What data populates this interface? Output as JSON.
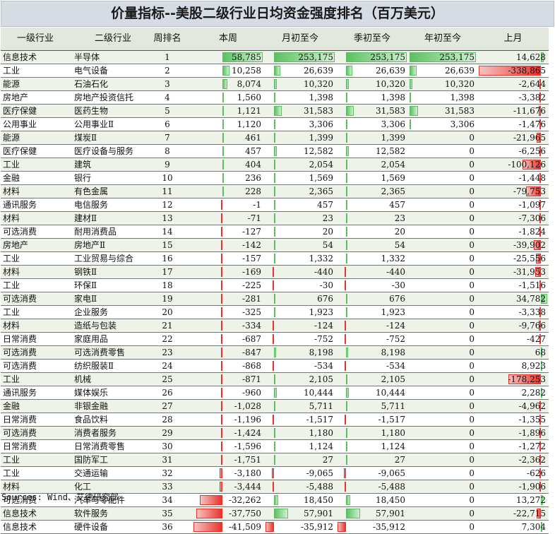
{
  "title": "价量指标--美股二级行业日均资金强度排名（百万美元）",
  "source": "Sources: Wind、艾德研究部",
  "chart_data": {
    "type": "table",
    "columns": [
      "一级行业",
      "二级行业",
      "周排名",
      "本周",
      "月初至今",
      "季初至今",
      "年初至今",
      "上月"
    ],
    "rows": [
      {
        "l1": "信息技术",
        "l2": "半导体",
        "rank": "1",
        "week": 58785,
        "week_s": "58,785",
        "mtd": 253175,
        "mtd_s": "253,175",
        "qtd": 253175,
        "qtd_s": "253,175",
        "ytd": 253175,
        "ytd_s": "253,175",
        "lm": 14628,
        "lm_s": "14,628"
      },
      {
        "l1": "工业",
        "l2": "电气设备",
        "rank": "2",
        "week": 10258,
        "week_s": "10,258",
        "mtd": 26639,
        "mtd_s": "26,639",
        "qtd": 26639,
        "qtd_s": "26,639",
        "ytd": 26639,
        "ytd_s": "26,639",
        "lm": -338865,
        "lm_s": "-338,865"
      },
      {
        "l1": "能源",
        "l2": "石油石化",
        "rank": "3",
        "week": 8074,
        "week_s": "8,074",
        "mtd": 10320,
        "mtd_s": "10,320",
        "qtd": 10320,
        "qtd_s": "10,320",
        "ytd": 10320,
        "ytd_s": "10,320",
        "lm": -2644,
        "lm_s": "-2,644"
      },
      {
        "l1": "房地产",
        "l2": "房地产投资信托",
        "rank": "4",
        "week": 1560,
        "week_s": "1,560",
        "mtd": 1398,
        "mtd_s": "1,398",
        "qtd": 1398,
        "qtd_s": "1,398",
        "ytd": 1398,
        "ytd_s": "1,398",
        "lm": -3382,
        "lm_s": "-3,382"
      },
      {
        "l1": "医疗保健",
        "l2": "医药生物",
        "rank": "5",
        "week": 1121,
        "week_s": "1,121",
        "mtd": 31583,
        "mtd_s": "31,583",
        "qtd": 31583,
        "qtd_s": "31,583",
        "ytd": 31583,
        "ytd_s": "31,583",
        "lm": -11676,
        "lm_s": "-11,676"
      },
      {
        "l1": "公用事业",
        "l2": "公用事业Ⅱ",
        "rank": "6",
        "week": 1120,
        "week_s": "1,120",
        "mtd": 3306,
        "mtd_s": "3,306",
        "qtd": 3306,
        "qtd_s": "3,306",
        "ytd": 3306,
        "ytd_s": "3,306",
        "lm": -1476,
        "lm_s": "-1,476"
      },
      {
        "l1": "能源",
        "l2": "煤炭Ⅱ",
        "rank": "7",
        "week": 461,
        "week_s": "461",
        "mtd": 1399,
        "mtd_s": "1,399",
        "qtd": 1399,
        "qtd_s": "1,399",
        "ytd": 0,
        "ytd_s": "0",
        "lm": -21965,
        "lm_s": "-21,965"
      },
      {
        "l1": "医疗保健",
        "l2": "医疗设备与服务",
        "rank": "8",
        "week": 457,
        "week_s": "457",
        "mtd": 12582,
        "mtd_s": "12,582",
        "qtd": 12582,
        "qtd_s": "12,582",
        "ytd": 0,
        "ytd_s": "0",
        "lm": -6256,
        "lm_s": "-6,256"
      },
      {
        "l1": "工业",
        "l2": "建筑",
        "rank": "9",
        "week": 404,
        "week_s": "404",
        "mtd": 2054,
        "mtd_s": "2,054",
        "qtd": 2054,
        "qtd_s": "2,054",
        "ytd": 0,
        "ytd_s": "0",
        "lm": -100126,
        "lm_s": "-100,126"
      },
      {
        "l1": "金融",
        "l2": "银行",
        "rank": "10",
        "week": 236,
        "week_s": "236",
        "mtd": 1569,
        "mtd_s": "1,569",
        "qtd": 1569,
        "qtd_s": "1,569",
        "ytd": 0,
        "ytd_s": "0",
        "lm": -1448,
        "lm_s": "-1,448"
      },
      {
        "l1": "材料",
        "l2": "有色金属",
        "rank": "11",
        "week": 228,
        "week_s": "228",
        "mtd": 2365,
        "mtd_s": "2,365",
        "qtd": 2365,
        "qtd_s": "2,365",
        "ytd": 0,
        "ytd_s": "0",
        "lm": -79753,
        "lm_s": "-79,753"
      },
      {
        "l1": "通讯服务",
        "l2": "电信服务",
        "rank": "12",
        "week": -1,
        "week_s": "-1",
        "mtd": 457,
        "mtd_s": "457",
        "qtd": 457,
        "qtd_s": "457",
        "ytd": 0,
        "ytd_s": "0",
        "lm": -1097,
        "lm_s": "-1,097"
      },
      {
        "l1": "材料",
        "l2": "建材Ⅱ",
        "rank": "13",
        "week": -71,
        "week_s": "-71",
        "mtd": 23,
        "mtd_s": "23",
        "qtd": 23,
        "qtd_s": "23",
        "ytd": 0,
        "ytd_s": "0",
        "lm": -7306,
        "lm_s": "-7,306"
      },
      {
        "l1": "可选消费",
        "l2": "耐用消费品",
        "rank": "14",
        "week": -127,
        "week_s": "-127",
        "mtd": 20,
        "mtd_s": "20",
        "qtd": 20,
        "qtd_s": "20",
        "ytd": 0,
        "ytd_s": "0",
        "lm": -1824,
        "lm_s": "-1,824"
      },
      {
        "l1": "房地产",
        "l2": "房地产Ⅱ",
        "rank": "15",
        "week": -142,
        "week_s": "-142",
        "mtd": 54,
        "mtd_s": "54",
        "qtd": 54,
        "qtd_s": "54",
        "ytd": 0,
        "ytd_s": "0",
        "lm": -39902,
        "lm_s": "-39,902"
      },
      {
        "l1": "工业",
        "l2": "工业贸易与综合",
        "rank": "16",
        "week": -157,
        "week_s": "-157",
        "mtd": 1332,
        "mtd_s": "1,332",
        "qtd": 1332,
        "qtd_s": "1,332",
        "ytd": 0,
        "ytd_s": "0",
        "lm": -25556,
        "lm_s": "-25,556"
      },
      {
        "l1": "材料",
        "l2": "钢铁Ⅱ",
        "rank": "17",
        "week": -169,
        "week_s": "-169",
        "mtd": -440,
        "mtd_s": "-440",
        "qtd": -440,
        "qtd_s": "-440",
        "ytd": 0,
        "ytd_s": "0",
        "lm": -31953,
        "lm_s": "-31,953"
      },
      {
        "l1": "工业",
        "l2": "环保Ⅱ",
        "rank": "18",
        "week": -225,
        "week_s": "-225",
        "mtd": -30,
        "mtd_s": "-30",
        "qtd": -30,
        "qtd_s": "-30",
        "ytd": 0,
        "ytd_s": "0",
        "lm": -1516,
        "lm_s": "-1,516"
      },
      {
        "l1": "可选消费",
        "l2": "家电Ⅱ",
        "rank": "19",
        "week": -281,
        "week_s": "-281",
        "mtd": 676,
        "mtd_s": "676",
        "qtd": 676,
        "qtd_s": "676",
        "ytd": 0,
        "ytd_s": "0",
        "lm": 34782,
        "lm_s": "34,782"
      },
      {
        "l1": "工业",
        "l2": "企业服务",
        "rank": "20",
        "week": -325,
        "week_s": "-325",
        "mtd": 1923,
        "mtd_s": "1,923",
        "qtd": 1923,
        "qtd_s": "1,923",
        "ytd": 0,
        "ytd_s": "0",
        "lm": -3338,
        "lm_s": "-3,338"
      },
      {
        "l1": "材料",
        "l2": "造纸与包装",
        "rank": "21",
        "week": -334,
        "week_s": "-334",
        "mtd": -124,
        "mtd_s": "-124",
        "qtd": -124,
        "qtd_s": "-124",
        "ytd": 0,
        "ytd_s": "0",
        "lm": -9766,
        "lm_s": "-9,766"
      },
      {
        "l1": "日常消费",
        "l2": "家庭用品",
        "rank": "22",
        "week": -687,
        "week_s": "-687",
        "mtd": -752,
        "mtd_s": "-752",
        "qtd": -752,
        "qtd_s": "-752",
        "ytd": 0,
        "ytd_s": "0",
        "lm": -427,
        "lm_s": "-427"
      },
      {
        "l1": "可选消费",
        "l2": "可选消费零售",
        "rank": "23",
        "week": -847,
        "week_s": "-847",
        "mtd": 8198,
        "mtd_s": "8,198",
        "qtd": 8198,
        "qtd_s": "8,198",
        "ytd": 0,
        "ytd_s": "0",
        "lm": 68,
        "lm_s": "68"
      },
      {
        "l1": "可选消费",
        "l2": "纺织服装Ⅱ",
        "rank": "24",
        "week": -868,
        "week_s": "-868",
        "mtd": -534,
        "mtd_s": "-534",
        "qtd": -534,
        "qtd_s": "-534",
        "ytd": 0,
        "ytd_s": "0",
        "lm": 8923,
        "lm_s": "8,923"
      },
      {
        "l1": "工业",
        "l2": "机械",
        "rank": "25",
        "week": -871,
        "week_s": "-871",
        "mtd": 2105,
        "mtd_s": "2,105",
        "qtd": 2105,
        "qtd_s": "2,105",
        "ytd": 0,
        "ytd_s": "0",
        "lm": -178253,
        "lm_s": "-178,253"
      },
      {
        "l1": "通讯服务",
        "l2": "媒体娱乐",
        "rank": "26",
        "week": -960,
        "week_s": "-960",
        "mtd": 10444,
        "mtd_s": "10,444",
        "qtd": 10444,
        "qtd_s": "10,444",
        "ytd": 0,
        "ytd_s": "0",
        "lm": 2282,
        "lm_s": "2,282"
      },
      {
        "l1": "金融",
        "l2": "非银金融",
        "rank": "27",
        "week": -1028,
        "week_s": "-1,028",
        "mtd": 5711,
        "mtd_s": "5,711",
        "qtd": 5711,
        "qtd_s": "5,711",
        "ytd": 0,
        "ytd_s": "0",
        "lm": -4962,
        "lm_s": "-4,962"
      },
      {
        "l1": "日常消费",
        "l2": "食品饮料",
        "rank": "28",
        "week": -1196,
        "week_s": "-1,196",
        "mtd": -1517,
        "mtd_s": "-1,517",
        "qtd": -1517,
        "qtd_s": "-1,517",
        "ytd": 0,
        "ytd_s": "0",
        "lm": -1355,
        "lm_s": "-1,355"
      },
      {
        "l1": "可选消费",
        "l2": "消费者服务",
        "rank": "29",
        "week": -1424,
        "week_s": "-1,424",
        "mtd": 1180,
        "mtd_s": "1,180",
        "qtd": 1180,
        "qtd_s": "1,180",
        "ytd": 0,
        "ytd_s": "0",
        "lm": -1896,
        "lm_s": "-1,896"
      },
      {
        "l1": "日常消费",
        "l2": "日常消费零售",
        "rank": "30",
        "week": -1596,
        "week_s": "-1,596",
        "mtd": 1124,
        "mtd_s": "1,124",
        "qtd": 1124,
        "qtd_s": "1,124",
        "ytd": 0,
        "ytd_s": "0",
        "lm": -1272,
        "lm_s": "-1,272"
      },
      {
        "l1": "工业",
        "l2": "国防军工",
        "rank": "31",
        "week": -1751,
        "week_s": "-1,751",
        "mtd": 27,
        "mtd_s": "27",
        "qtd": 27,
        "qtd_s": "27",
        "ytd": 0,
        "ytd_s": "0",
        "lm": -2362,
        "lm_s": "-2,362"
      },
      {
        "l1": "工业",
        "l2": "交通运输",
        "rank": "32",
        "week": -3180,
        "week_s": "-3,180",
        "mtd": -9065,
        "mtd_s": "-9,065",
        "qtd": -9065,
        "qtd_s": "-9,065",
        "ytd": 0,
        "ytd_s": "0",
        "lm": -626,
        "lm_s": "-626"
      },
      {
        "l1": "材料",
        "l2": "化工",
        "rank": "33",
        "week": -3444,
        "week_s": "-3,444",
        "mtd": -5488,
        "mtd_s": "-5,488",
        "qtd": -5488,
        "qtd_s": "-5,488",
        "ytd": 0,
        "ytd_s": "0",
        "lm": -1906,
        "lm_s": "-1,906"
      },
      {
        "l1": "可选消费",
        "l2": "汽车与零配件",
        "rank": "34",
        "week": -32262,
        "week_s": "-32,262",
        "mtd": 18450,
        "mtd_s": "18,450",
        "qtd": 18450,
        "qtd_s": "18,450",
        "ytd": 0,
        "ytd_s": "0",
        "lm": 13272,
        "lm_s": "13,272"
      },
      {
        "l1": "信息技术",
        "l2": "软件服务",
        "rank": "35",
        "week": -37750,
        "week_s": "-37,750",
        "mtd": 57901,
        "mtd_s": "57,901",
        "qtd": 57901,
        "qtd_s": "57,901",
        "ytd": 0,
        "ytd_s": "0",
        "lm": -22715,
        "lm_s": "-22,715"
      },
      {
        "l1": "信息技术",
        "l2": "硬件设备",
        "rank": "36",
        "week": -41509,
        "week_s": "-41,509",
        "mtd": -35912,
        "mtd_s": "-35,912",
        "qtd": -35912,
        "qtd_s": "-35,912",
        "ytd": 0,
        "ytd_s": "0",
        "lm": 7304,
        "lm_s": "7,304"
      }
    ],
    "bar_colors": {
      "positive": "#5cc062",
      "negative": "#e8332a"
    }
  }
}
